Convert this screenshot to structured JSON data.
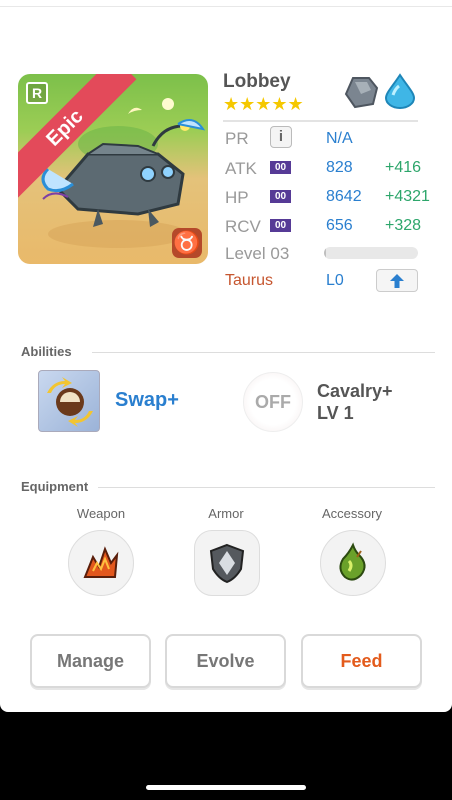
{
  "monster": {
    "name": "Lobbey",
    "rarity": "Epic",
    "rarity_icon": "R",
    "stars": "★★★★★",
    "zodiac_icon": "taurus-glyph",
    "zodiac_glyph": "♉"
  },
  "stats": {
    "pr": {
      "label": "PR",
      "value": "N/A",
      "info_icon": "i"
    },
    "atk": {
      "label": "ATK",
      "badge": "00",
      "value": "828",
      "plus": "+416"
    },
    "hp": {
      "label": "HP",
      "badge": "00",
      "value": "8642",
      "plus": "+4321"
    },
    "rcv": {
      "label": "RCV",
      "badge": "00",
      "value": "656",
      "plus": "+328"
    },
    "level": {
      "label": "Level 03",
      "progress": 0.02
    },
    "sign": {
      "label": "Taurus",
      "value": "L0"
    }
  },
  "abilities": {
    "section_label": "Abilities",
    "items": [
      {
        "name": "Swap+"
      },
      {
        "name": "Cavalry+",
        "sub": "LV 1",
        "state": "OFF"
      }
    ]
  },
  "equipment": {
    "section_label": "Equipment",
    "slots": [
      {
        "label": "Weapon"
      },
      {
        "label": "Armor"
      },
      {
        "label": "Accessory"
      }
    ]
  },
  "actions": {
    "manage": "Manage",
    "evolve": "Evolve",
    "feed": "Feed"
  },
  "colors": {
    "accent_blue": "#2a7fcf",
    "bonus_green": "#2da66b",
    "epic_red": "#e34a5a",
    "feed_orange": "#e35b1c",
    "star_gold": "#f5c800"
  }
}
